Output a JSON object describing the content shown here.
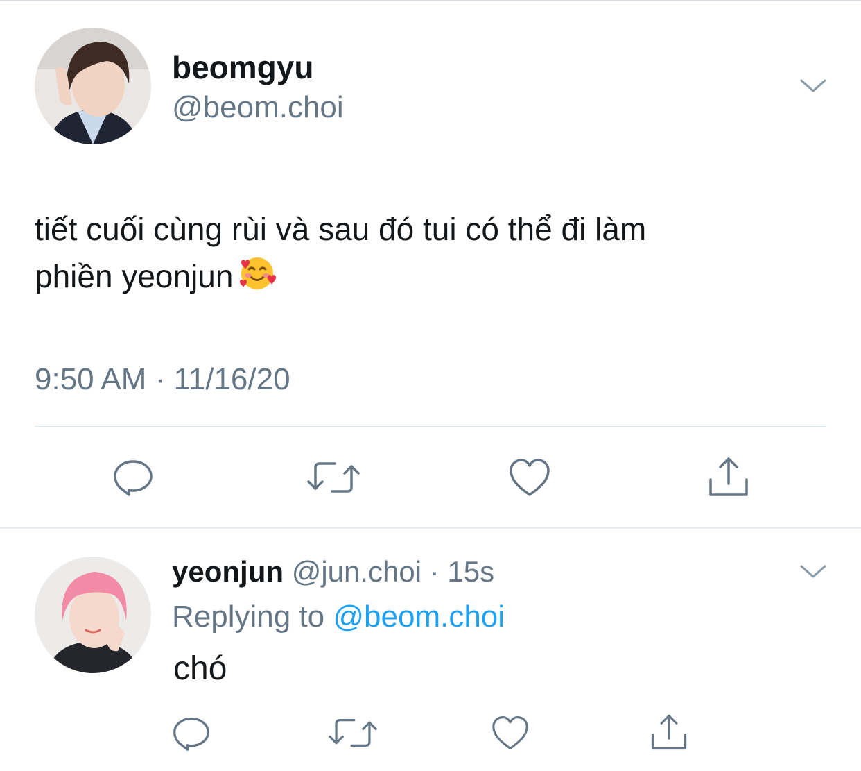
{
  "main_tweet": {
    "display_name": "beomgyu",
    "handle": "@beom.choi",
    "text_line1": "tiết cuối cùng rùi và sau đó tui có thể đi làm",
    "text_line2": "phiền yeonjun",
    "emoji_icon": "smiling-face-with-hearts-icon",
    "timestamp": "9:50 AM · 11/16/20"
  },
  "reply_tweet": {
    "display_name": "yeonjun",
    "handle": "@jun.choi",
    "separator": " · ",
    "age": "15s",
    "replying_prefix": "Replying to ",
    "replying_to": "@beom.choi",
    "text": "chó"
  },
  "actions": [
    "reply-icon",
    "retweet-icon",
    "like-icon",
    "share-icon"
  ],
  "colors": {
    "text": "#14171a",
    "secondary": "#657786",
    "link": "#1da1f2",
    "divider": "#e1e8ed"
  }
}
